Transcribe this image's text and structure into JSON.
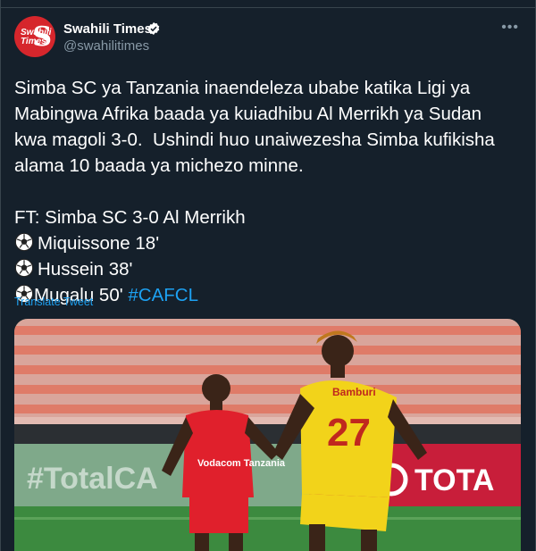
{
  "account": {
    "name": "Swahili Times",
    "handle": "@swahilitimes",
    "avatar_text": "Swahili Times",
    "avatar_letter": "S"
  },
  "tweet": {
    "line1": "Simba SC ya Tanzania inaendeleza ubabe katika Ligi ya",
    "line2": "Mabingwa Afrika baada ya kuiadhibu Al Merrikh ya Sudan",
    "line3": "kwa magoli 3-0.  Ushindi huo unaiwezesha Simba kufikisha",
    "line4": "alama 10 baada ya michezo minne.",
    "result": "FT: Simba SC 3-0 Al Merrikh",
    "goal1": "Miquissone 18'",
    "goal2": "Hussein 38'",
    "goal3": "Mugalu 50'",
    "hashtag": "#CAFCL"
  },
  "translate_label": "Translate Tweet",
  "photo": {
    "banner_left": "#TotalCA",
    "banner_right": "TOTA",
    "shirt_left": "Vodacom Tanzania",
    "shirt_right": "Bamburi",
    "number_right": "27"
  },
  "colors": {
    "background": "#15202b",
    "link": "#1da1f2",
    "muted": "#8899a6",
    "brand_red": "#d6262c"
  },
  "icons": [
    "verified-badge-icon",
    "more-options-icon",
    "soccer-ball-icon"
  ]
}
